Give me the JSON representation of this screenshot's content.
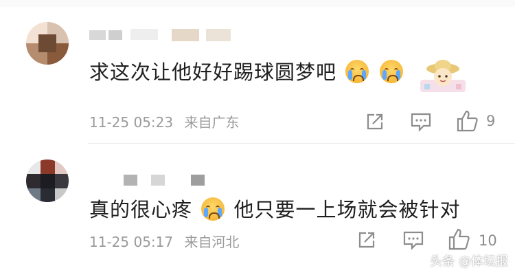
{
  "comments": [
    {
      "text_before_emoji": "求这次让他好好踢球圆梦吧",
      "emojis": [
        "crying-face",
        "crying-face"
      ],
      "sticker": "straw-hat-cartoon-sticker",
      "time": "11-25 05:23",
      "location": "来自广东",
      "like_count": "9"
    },
    {
      "text_before_emoji": "真的很心疼",
      "emojis": [
        "crying-face"
      ],
      "text_after_emoji": "他只要一上场就会被针对",
      "time": "11-25 05:17",
      "location": "来自河北",
      "like_count": "10"
    }
  ],
  "watermark": "头条 @体坛报",
  "icons": {
    "share": "share-icon",
    "comment": "comment-icon",
    "like": "thumbs-up-icon"
  },
  "colors": {
    "text": "#1f1f1f",
    "meta": "#9a9a9a",
    "emoji": "#f6b93b"
  }
}
